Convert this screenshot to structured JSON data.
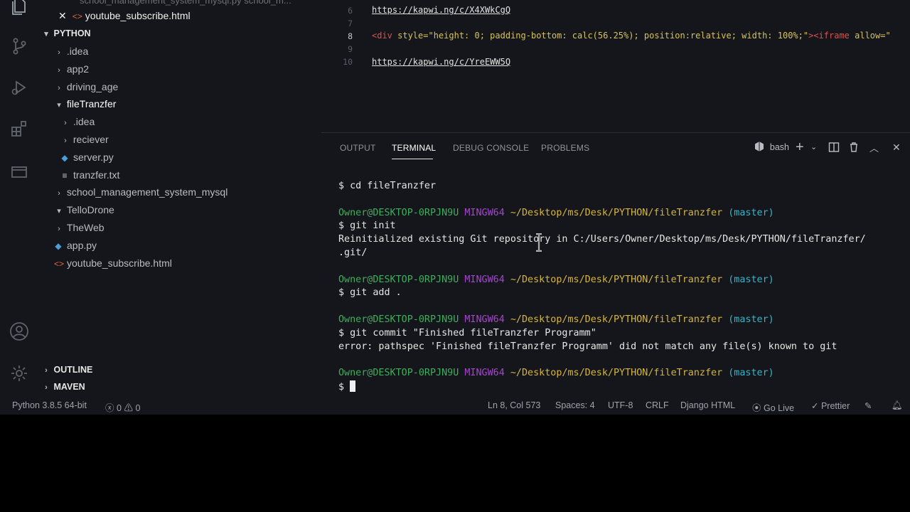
{
  "sidebar": {
    "top_partial_item": "school_management_system_mysql.py  school_m...",
    "open_editor": {
      "label": "youtube_subscribe.html"
    },
    "root": "PYTHON",
    "items": [
      {
        "label": ".idea",
        "type": "folder",
        "depth": 1,
        "expanded": false
      },
      {
        "label": "app2",
        "type": "folder",
        "depth": 1,
        "expanded": false
      },
      {
        "label": "driving_age",
        "type": "folder",
        "depth": 1,
        "expanded": false
      },
      {
        "label": "fileTranzfer",
        "type": "folder",
        "depth": 1,
        "expanded": true
      },
      {
        "label": ".idea",
        "type": "folder",
        "depth": 2,
        "expanded": false
      },
      {
        "label": "reciever",
        "type": "folder",
        "depth": 2,
        "expanded": false
      },
      {
        "label": "server.py",
        "type": "python",
        "depth": 2
      },
      {
        "label": "tranzfer.txt",
        "type": "text",
        "depth": 2
      },
      {
        "label": "school_management_system_mysql",
        "type": "folder",
        "depth": 1,
        "expanded": false
      },
      {
        "label": "TelloDrone",
        "type": "folder",
        "depth": 1,
        "expanded": true
      },
      {
        "label": "TheWeb",
        "type": "folder",
        "depth": 1,
        "expanded": false
      },
      {
        "label": "app.py",
        "type": "python",
        "depth": 1
      },
      {
        "label": "youtube_subscribe.html",
        "type": "html",
        "depth": 1
      }
    ],
    "outline": "OUTLINE",
    "maven": "MAVEN"
  },
  "editor": {
    "lines": [
      {
        "num": "6",
        "text": "https://kapwi.ng/c/X4XWkCgQ"
      },
      {
        "num": "7",
        "text": ""
      },
      {
        "num": "8",
        "text_tag": "<div",
        "text_attr": " style=\"height: 0; padding-bottom: calc(56.25%); position:relative; width: 100%;\"",
        "text_tag2": "><iframe",
        "text_attr2": " allow=\""
      },
      {
        "num": "9",
        "text": ""
      },
      {
        "num": "10",
        "text": "https://kapwi.ng/c/YreEWW5Q"
      }
    ]
  },
  "panel": {
    "tabs": [
      "OUTPUT",
      "TERMINAL",
      "DEBUG CONSOLE",
      "PROBLEMS"
    ],
    "active_tab": "TERMINAL",
    "shell": "bash",
    "terminal": {
      "cmd1": "$ cd fileTranzfer",
      "prompt_user": "Owner@DESKTOP-0RPJN9U",
      "prompt_ming": "MINGW64",
      "prompt_path": "~/Desktop/ms/Desk/PYTHON/fileTranzfer",
      "prompt_branch": "(master)",
      "cmd2": "$ git init",
      "out2a": "Reinitialized existing Git repository in C:/Users/Owner/Desktop/ms/Desk/PYTHON/fileTranzfer/",
      "out2b": ".git/",
      "cmd3": "$ git add .",
      "cmd4": "$ git commit \"Finished fileTranzfer Programm\"",
      "out4": "error: pathspec 'Finished fileTranzfer Programm' did not match any file(s) known to git",
      "cmd5": "$ "
    }
  },
  "status": {
    "python": "Python 3.8.5 64-bit",
    "errors": "0",
    "warnings": "0",
    "position": "Ln 8, Col 573",
    "spaces": "Spaces: 4",
    "encoding": "UTF-8",
    "eol": "CRLF",
    "language": "Django HTML",
    "golive": "Go Live",
    "prettier": "Prettier"
  },
  "colors": {
    "background": "#14161b",
    "prompt_user": "#3fae5c",
    "prompt_mingw": "#a347c8",
    "prompt_path": "#d6b53a",
    "prompt_branch": "#36b5c8",
    "html_tag": "#d9534f",
    "html_attr": "#d7c25a"
  }
}
